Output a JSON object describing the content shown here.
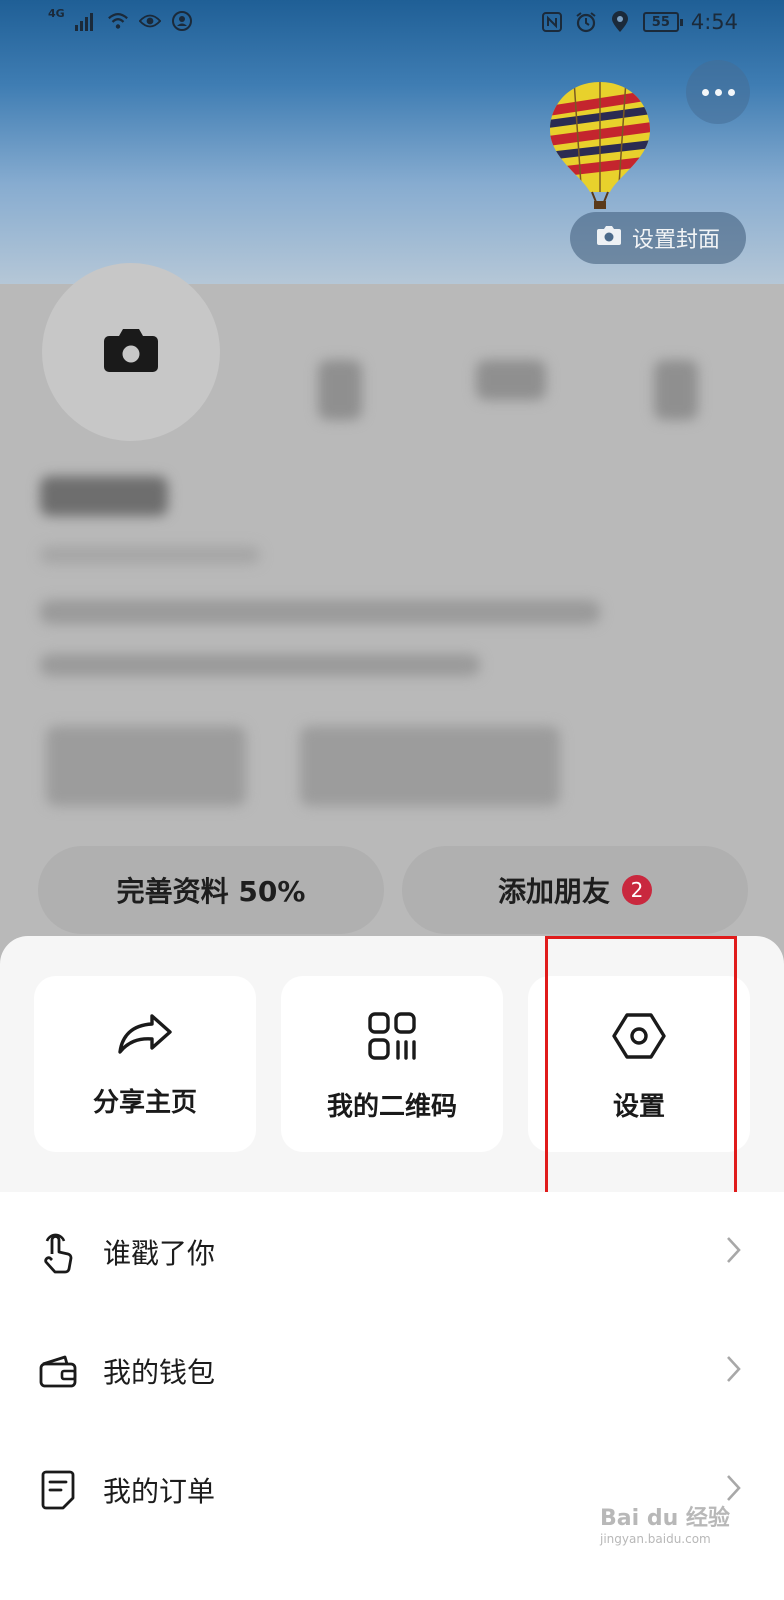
{
  "status_bar": {
    "signal_label": "4G",
    "battery": "55",
    "time": "4:54"
  },
  "cover": {
    "set_cover_label": "设置封面"
  },
  "profile_actions": {
    "complete_profile_label": "完善资料 50%",
    "add_friends_label": "添加朋友",
    "add_friends_badge": "2"
  },
  "sheet": {
    "cards": [
      {
        "label": "分享主页",
        "icon": "share-icon"
      },
      {
        "label": "我的二维码",
        "icon": "qr-code-icon"
      },
      {
        "label": "设置",
        "icon": "settings-icon"
      }
    ],
    "rows": [
      {
        "label": "谁戳了你",
        "icon": "poke-hand-icon"
      },
      {
        "label": "我的钱包",
        "icon": "wallet-icon"
      },
      {
        "label": "我的订单",
        "icon": "order-icon"
      }
    ]
  },
  "watermark": {
    "text": "Bai du 经验",
    "subtext": "jingyan.baidu.com"
  },
  "colors": {
    "highlight": "#e01b1b",
    "badge": "#c9283e"
  }
}
